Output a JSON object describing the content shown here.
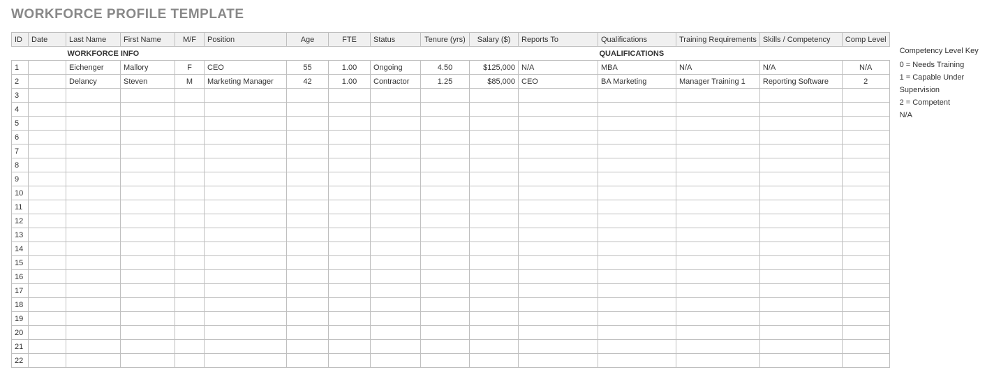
{
  "title": "WORKFORCE PROFILE TEMPLATE",
  "section_a": "WORKFORCE INFO",
  "section_b": "QUALIFICATIONS",
  "columns": {
    "id": "ID",
    "date": "Date",
    "last_name": "Last Name",
    "first_name": "First Name",
    "mf": "M/F",
    "position": "Position",
    "age": "Age",
    "fte": "FTE",
    "status": "Status",
    "tenure": "Tenure (yrs)",
    "salary": "Salary ($)",
    "reports_to": "Reports To",
    "qualifications": "Qualifications",
    "training": "Training Requirements",
    "skills": "Skills / Competency",
    "comp_level": "Comp Level"
  },
  "rows": [
    {
      "id": "1",
      "date": "",
      "last_name": "Eichenger",
      "first_name": "Mallory",
      "mf": "F",
      "position": "CEO",
      "age": "55",
      "fte": "1.00",
      "status": "Ongoing",
      "tenure": "4.50",
      "salary": "$125,000",
      "reports_to": "N/A",
      "qualifications": "MBA",
      "training": "N/A",
      "skills": "N/A",
      "comp_level": "N/A"
    },
    {
      "id": "2",
      "date": "",
      "last_name": "Delancy",
      "first_name": "Steven",
      "mf": "M",
      "position": "Marketing Manager",
      "age": "42",
      "fte": "1.00",
      "status": "Contractor",
      "tenure": "1.25",
      "salary": "$85,000",
      "reports_to": "CEO",
      "qualifications": "BA Marketing",
      "training": "Manager Training 1",
      "skills": "Reporting Software",
      "comp_level": "2"
    },
    {
      "id": "3",
      "date": "",
      "last_name": "",
      "first_name": "",
      "mf": "",
      "position": "",
      "age": "",
      "fte": "",
      "status": "",
      "tenure": "",
      "salary": "",
      "reports_to": "",
      "qualifications": "",
      "training": "",
      "skills": "",
      "comp_level": ""
    },
    {
      "id": "4",
      "date": "",
      "last_name": "",
      "first_name": "",
      "mf": "",
      "position": "",
      "age": "",
      "fte": "",
      "status": "",
      "tenure": "",
      "salary": "",
      "reports_to": "",
      "qualifications": "",
      "training": "",
      "skills": "",
      "comp_level": ""
    },
    {
      "id": "5",
      "date": "",
      "last_name": "",
      "first_name": "",
      "mf": "",
      "position": "",
      "age": "",
      "fte": "",
      "status": "",
      "tenure": "",
      "salary": "",
      "reports_to": "",
      "qualifications": "",
      "training": "",
      "skills": "",
      "comp_level": ""
    },
    {
      "id": "6",
      "date": "",
      "last_name": "",
      "first_name": "",
      "mf": "",
      "position": "",
      "age": "",
      "fte": "",
      "status": "",
      "tenure": "",
      "salary": "",
      "reports_to": "",
      "qualifications": "",
      "training": "",
      "skills": "",
      "comp_level": ""
    },
    {
      "id": "7",
      "date": "",
      "last_name": "",
      "first_name": "",
      "mf": "",
      "position": "",
      "age": "",
      "fte": "",
      "status": "",
      "tenure": "",
      "salary": "",
      "reports_to": "",
      "qualifications": "",
      "training": "",
      "skills": "",
      "comp_level": ""
    },
    {
      "id": "8",
      "date": "",
      "last_name": "",
      "first_name": "",
      "mf": "",
      "position": "",
      "age": "",
      "fte": "",
      "status": "",
      "tenure": "",
      "salary": "",
      "reports_to": "",
      "qualifications": "",
      "training": "",
      "skills": "",
      "comp_level": ""
    },
    {
      "id": "9",
      "date": "",
      "last_name": "",
      "first_name": "",
      "mf": "",
      "position": "",
      "age": "",
      "fte": "",
      "status": "",
      "tenure": "",
      "salary": "",
      "reports_to": "",
      "qualifications": "",
      "training": "",
      "skills": "",
      "comp_level": ""
    },
    {
      "id": "10",
      "date": "",
      "last_name": "",
      "first_name": "",
      "mf": "",
      "position": "",
      "age": "",
      "fte": "",
      "status": "",
      "tenure": "",
      "salary": "",
      "reports_to": "",
      "qualifications": "",
      "training": "",
      "skills": "",
      "comp_level": ""
    },
    {
      "id": "11",
      "date": "",
      "last_name": "",
      "first_name": "",
      "mf": "",
      "position": "",
      "age": "",
      "fte": "",
      "status": "",
      "tenure": "",
      "salary": "",
      "reports_to": "",
      "qualifications": "",
      "training": "",
      "skills": "",
      "comp_level": ""
    },
    {
      "id": "12",
      "date": "",
      "last_name": "",
      "first_name": "",
      "mf": "",
      "position": "",
      "age": "",
      "fte": "",
      "status": "",
      "tenure": "",
      "salary": "",
      "reports_to": "",
      "qualifications": "",
      "training": "",
      "skills": "",
      "comp_level": ""
    },
    {
      "id": "13",
      "date": "",
      "last_name": "",
      "first_name": "",
      "mf": "",
      "position": "",
      "age": "",
      "fte": "",
      "status": "",
      "tenure": "",
      "salary": "",
      "reports_to": "",
      "qualifications": "",
      "training": "",
      "skills": "",
      "comp_level": ""
    },
    {
      "id": "14",
      "date": "",
      "last_name": "",
      "first_name": "",
      "mf": "",
      "position": "",
      "age": "",
      "fte": "",
      "status": "",
      "tenure": "",
      "salary": "",
      "reports_to": "",
      "qualifications": "",
      "training": "",
      "skills": "",
      "comp_level": ""
    },
    {
      "id": "15",
      "date": "",
      "last_name": "",
      "first_name": "",
      "mf": "",
      "position": "",
      "age": "",
      "fte": "",
      "status": "",
      "tenure": "",
      "salary": "",
      "reports_to": "",
      "qualifications": "",
      "training": "",
      "skills": "",
      "comp_level": ""
    },
    {
      "id": "16",
      "date": "",
      "last_name": "",
      "first_name": "",
      "mf": "",
      "position": "",
      "age": "",
      "fte": "",
      "status": "",
      "tenure": "",
      "salary": "",
      "reports_to": "",
      "qualifications": "",
      "training": "",
      "skills": "",
      "comp_level": ""
    },
    {
      "id": "17",
      "date": "",
      "last_name": "",
      "first_name": "",
      "mf": "",
      "position": "",
      "age": "",
      "fte": "",
      "status": "",
      "tenure": "",
      "salary": "",
      "reports_to": "",
      "qualifications": "",
      "training": "",
      "skills": "",
      "comp_level": ""
    },
    {
      "id": "18",
      "date": "",
      "last_name": "",
      "first_name": "",
      "mf": "",
      "position": "",
      "age": "",
      "fte": "",
      "status": "",
      "tenure": "",
      "salary": "",
      "reports_to": "",
      "qualifications": "",
      "training": "",
      "skills": "",
      "comp_level": ""
    },
    {
      "id": "19",
      "date": "",
      "last_name": "",
      "first_name": "",
      "mf": "",
      "position": "",
      "age": "",
      "fte": "",
      "status": "",
      "tenure": "",
      "salary": "",
      "reports_to": "",
      "qualifications": "",
      "training": "",
      "skills": "",
      "comp_level": ""
    },
    {
      "id": "20",
      "date": "",
      "last_name": "",
      "first_name": "",
      "mf": "",
      "position": "",
      "age": "",
      "fte": "",
      "status": "",
      "tenure": "",
      "salary": "",
      "reports_to": "",
      "qualifications": "",
      "training": "",
      "skills": "",
      "comp_level": ""
    },
    {
      "id": "21",
      "date": "",
      "last_name": "",
      "first_name": "",
      "mf": "",
      "position": "",
      "age": "",
      "fte": "",
      "status": "",
      "tenure": "",
      "salary": "",
      "reports_to": "",
      "qualifications": "",
      "training": "",
      "skills": "",
      "comp_level": ""
    },
    {
      "id": "22",
      "date": "",
      "last_name": "",
      "first_name": "",
      "mf": "",
      "position": "",
      "age": "",
      "fte": "",
      "status": "",
      "tenure": "",
      "salary": "",
      "reports_to": "",
      "qualifications": "",
      "training": "",
      "skills": "",
      "comp_level": ""
    }
  ],
  "legend": {
    "title": "Competency Level Key",
    "items": [
      "0 = Needs Training",
      "1 = Capable Under Supervision",
      "2 = Competent",
      "N/A"
    ]
  }
}
